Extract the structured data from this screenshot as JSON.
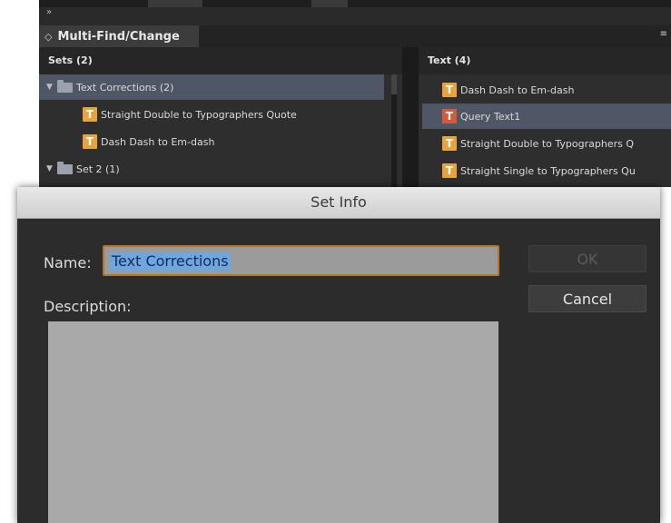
{
  "panel": {
    "title": "Multi-Find/Change",
    "tab_arrows": "◇",
    "collapse_glyph": "»",
    "menu_glyph": "≡",
    "sets": {
      "header": "Sets (2)",
      "items": [
        {
          "label": "Text Corrections (2)",
          "type": "folder",
          "expanded": true,
          "selected": true
        },
        {
          "label": "Straight Double to Typographers Quote",
          "type": "query"
        },
        {
          "label": "Dash Dash to Em-dash",
          "type": "query"
        },
        {
          "label": "Set 2 (1)",
          "type": "folder",
          "expanded": true
        }
      ]
    },
    "text": {
      "header": "Text (4)",
      "items": [
        {
          "label": "Dash Dash to Em-dash"
        },
        {
          "label": "Query Text1",
          "selected": true
        },
        {
          "label": "Straight Double to Typographers Q"
        },
        {
          "label": "Straight Single to Typographers Qu"
        }
      ]
    },
    "icon_glyph": "T"
  },
  "dialog": {
    "title": "Set Info",
    "name_label": "Name:",
    "name_value": "Text Corrections",
    "description_label": "Description:",
    "description_value": "",
    "ok_label": "OK",
    "ok_enabled": false,
    "cancel_label": "Cancel"
  },
  "colors": {
    "selection_highlight": "#4f5766",
    "text_icon": "#e8a33c",
    "focus_ring": "#b3742b",
    "selected_text_bg": "#6ea6e0"
  }
}
